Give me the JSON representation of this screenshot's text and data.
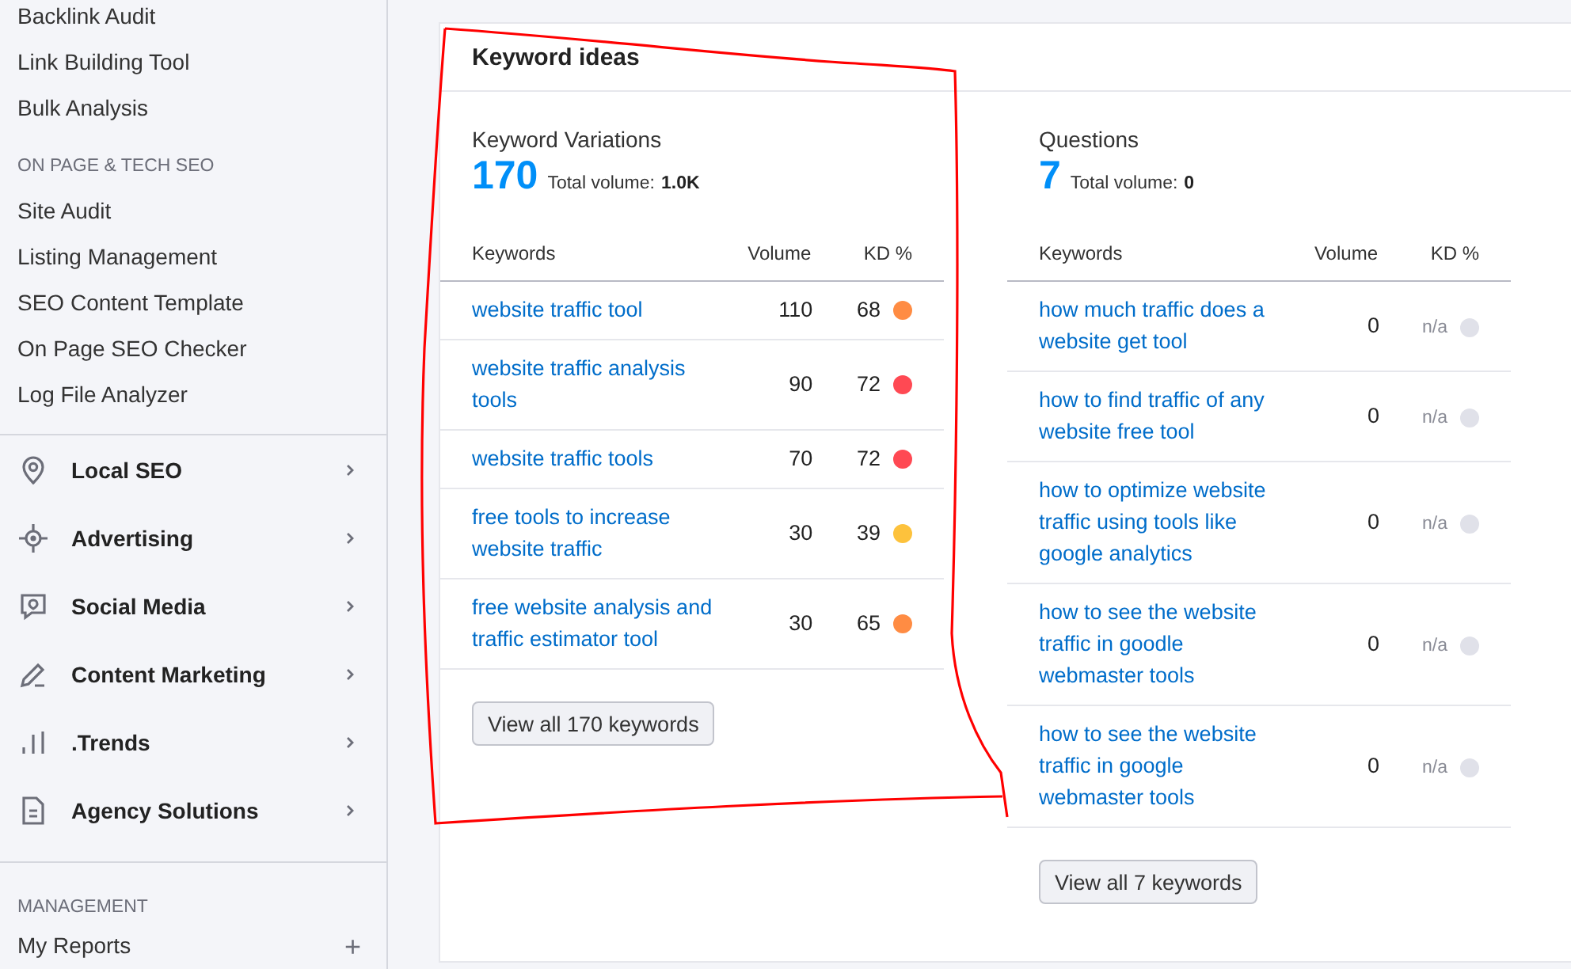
{
  "sidebar": {
    "tools": [
      "Backlink Audit",
      "Link Building Tool",
      "Bulk Analysis"
    ],
    "groups": [
      {
        "heading": "ON PAGE & TECH SEO",
        "items": [
          "Site Audit",
          "Listing Management",
          "SEO Content Template",
          "On Page SEO Checker",
          "Log File Analyzer"
        ]
      }
    ],
    "menus": [
      {
        "label": "Local SEO",
        "expanded": false
      },
      {
        "label": "Advertising",
        "expanded": false
      },
      {
        "label": "Social Media",
        "expanded": false
      },
      {
        "label": "Content Marketing",
        "expanded": false
      },
      {
        "label": ".Trends",
        "expanded": false
      },
      {
        "label": "Agency Solutions",
        "expanded": false
      }
    ],
    "management": {
      "heading": "MANAGEMENT",
      "items": [
        {
          "label": "My Reports",
          "action": "+"
        }
      ]
    }
  },
  "card": {
    "title": "Keyword ideas",
    "panels": [
      {
        "heading": "Keyword Variations",
        "count": "170",
        "total_label": "Total volume:",
        "total": "1.0K",
        "columns": [
          "Keywords",
          "Volume",
          "KD %"
        ],
        "rows": [
          {
            "keyword": "website traffic tool",
            "volume": "110",
            "kd": "68",
            "kd_muted": false,
            "color": "#ff8c43"
          },
          {
            "keyword": "website traffic analysis tools",
            "volume": "90",
            "kd": "72",
            "kd_muted": false,
            "color": "#ff4953"
          },
          {
            "keyword": "website traffic tools",
            "volume": "70",
            "kd": "72",
            "kd_muted": false,
            "color": "#ff4953"
          },
          {
            "keyword": "free tools to increase website traffic",
            "volume": "30",
            "kd": "39",
            "kd_muted": false,
            "color": "#fdc23c"
          },
          {
            "keyword": "free website analysis and traffic estimator tool",
            "volume": "30",
            "kd": "65",
            "kd_muted": false,
            "color": "#ff8c43"
          }
        ],
        "button": "View all 170 keywords"
      },
      {
        "heading": "Questions",
        "count": "7",
        "total_label": "Total volume:",
        "total": "0",
        "columns": [
          "Keywords",
          "Volume",
          "KD %"
        ],
        "rows": [
          {
            "keyword": "how much traffic does a website get tool",
            "volume": "0",
            "kd": "n/a",
            "kd_muted": true,
            "color": "#e0e1e9"
          },
          {
            "keyword": "how to find traffic of any website free tool",
            "volume": "0",
            "kd": "n/a",
            "kd_muted": true,
            "color": "#e0e1e9"
          },
          {
            "keyword": "how to optimize website traffic using tools like google analytics",
            "volume": "0",
            "kd": "n/a",
            "kd_muted": true,
            "color": "#e0e1e9"
          },
          {
            "keyword": "how to see the website traffic in goodle webmaster tools",
            "volume": "0",
            "kd": "n/a",
            "kd_muted": true,
            "color": "#e0e1e9"
          },
          {
            "keyword": "how to see the website traffic in google webmaster tools",
            "volume": "0",
            "kd": "n/a",
            "kd_muted": true,
            "color": "#e0e1e9"
          }
        ],
        "button": "View all 7 keywords"
      }
    ]
  },
  "annotation": {
    "kind": "freehand-outline"
  }
}
